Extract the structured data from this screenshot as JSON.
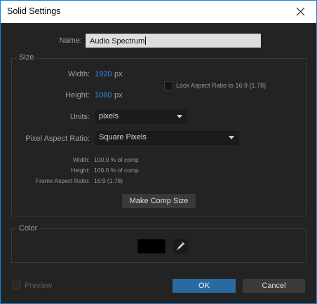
{
  "window": {
    "title": "Solid Settings"
  },
  "name": {
    "label": "Name:",
    "value": "Audio Spectrum"
  },
  "size": {
    "group_title": "Size",
    "width_label": "Width:",
    "width_value": "1920",
    "width_unit": "px",
    "height_label": "Height:",
    "height_value": "1080",
    "height_unit": "px",
    "lock_label": "Lock Aspect Ratio to 16:9 (1.78)",
    "lock_checked": false,
    "units_label": "Units:",
    "units_value": "pixels",
    "par_label": "Pixel Aspect Ratio:",
    "par_value": "Square Pixels",
    "info_width_label": "Width:",
    "info_width_value": "100.0 % of comp",
    "info_height_label": "Height:",
    "info_height_value": "100.0 % of comp",
    "info_far_label": "Frame Aspect Ratio:",
    "info_far_value": "16:9 (1.78)",
    "make_comp_size": "Make Comp Size"
  },
  "color": {
    "group_title": "Color",
    "swatch_hex": "#000000"
  },
  "footer": {
    "preview_label": "Preview",
    "ok_label": "OK",
    "cancel_label": "Cancel"
  }
}
